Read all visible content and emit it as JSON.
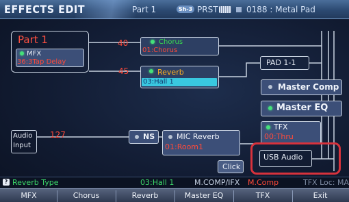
{
  "title_bar": {
    "screen_title": "EFFECTS EDIT",
    "part": "Part 1",
    "pad_badge": "Sh-3",
    "preset_mode": "PRST",
    "patch": "0188 : Metal Pad"
  },
  "part1": {
    "label": "Part 1",
    "mfx": {
      "name": "MFX",
      "value": "36:3Tap Delay"
    },
    "chorus_send": "40",
    "reverb_send": "45"
  },
  "chorus": {
    "name": "Chorus",
    "value": "01:Chorus"
  },
  "reverb": {
    "name": "Reverb",
    "value": "03:Hall 1"
  },
  "pad": {
    "label": "PAD 1-1"
  },
  "master_comp": {
    "label": "Master Comp"
  },
  "master_eq": {
    "label": "Master EQ"
  },
  "tfx": {
    "name": "TFX",
    "value": "00:Thru"
  },
  "usb_audio": {
    "label": "USB Audio"
  },
  "audio_input": {
    "line1": "Audio",
    "line2": "Input",
    "send": "127"
  },
  "ns": {
    "label": "NS"
  },
  "mic_reverb": {
    "name": "MIC Reverb",
    "value": "01:Room1"
  },
  "click": {
    "label": "Click"
  },
  "status": {
    "param_name": "Reverb Type",
    "param_value": "03:Hall 1",
    "routing_label": "M.COMP/IFX",
    "routing_value": "M.Comp",
    "tfx_location": "TFX Loc: MAIN"
  },
  "function_bar": [
    "MFX",
    "Chorus",
    "Reverb",
    "Master EQ",
    "TFX",
    "Exit"
  ],
  "colors": {
    "accent_red": "#ff4a3a",
    "accent_green": "#3dd86a",
    "selected_cyan": "#39c8e0",
    "highlight_ring": "#d8323c"
  },
  "icons": {
    "led_on": "green-led-icon",
    "led_off": "gray-led-icon",
    "keyboard": "keyboard-icon",
    "param": "parameter-icon"
  }
}
